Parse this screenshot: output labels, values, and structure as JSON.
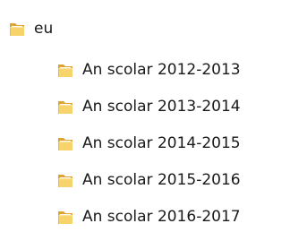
{
  "tree": {
    "root": {
      "label": "eu",
      "icon": "folder-icon"
    },
    "children": [
      {
        "label": "An scolar 2012-2013",
        "icon": "folder-icon"
      },
      {
        "label": "An scolar 2013-2014",
        "icon": "folder-icon"
      },
      {
        "label": "An scolar 2014-2015",
        "icon": "folder-icon"
      },
      {
        "label": "An scolar 2015-2016",
        "icon": "folder-icon"
      },
      {
        "label": "An scolar 2016-2017",
        "icon": "folder-icon"
      }
    ]
  },
  "colors": {
    "folder_light": "#f6d36b",
    "folder_mid": "#e8b13f",
    "folder_dark": "#c98a1c",
    "folder_paper": "#ffffff",
    "text": "#1a1a1a"
  }
}
